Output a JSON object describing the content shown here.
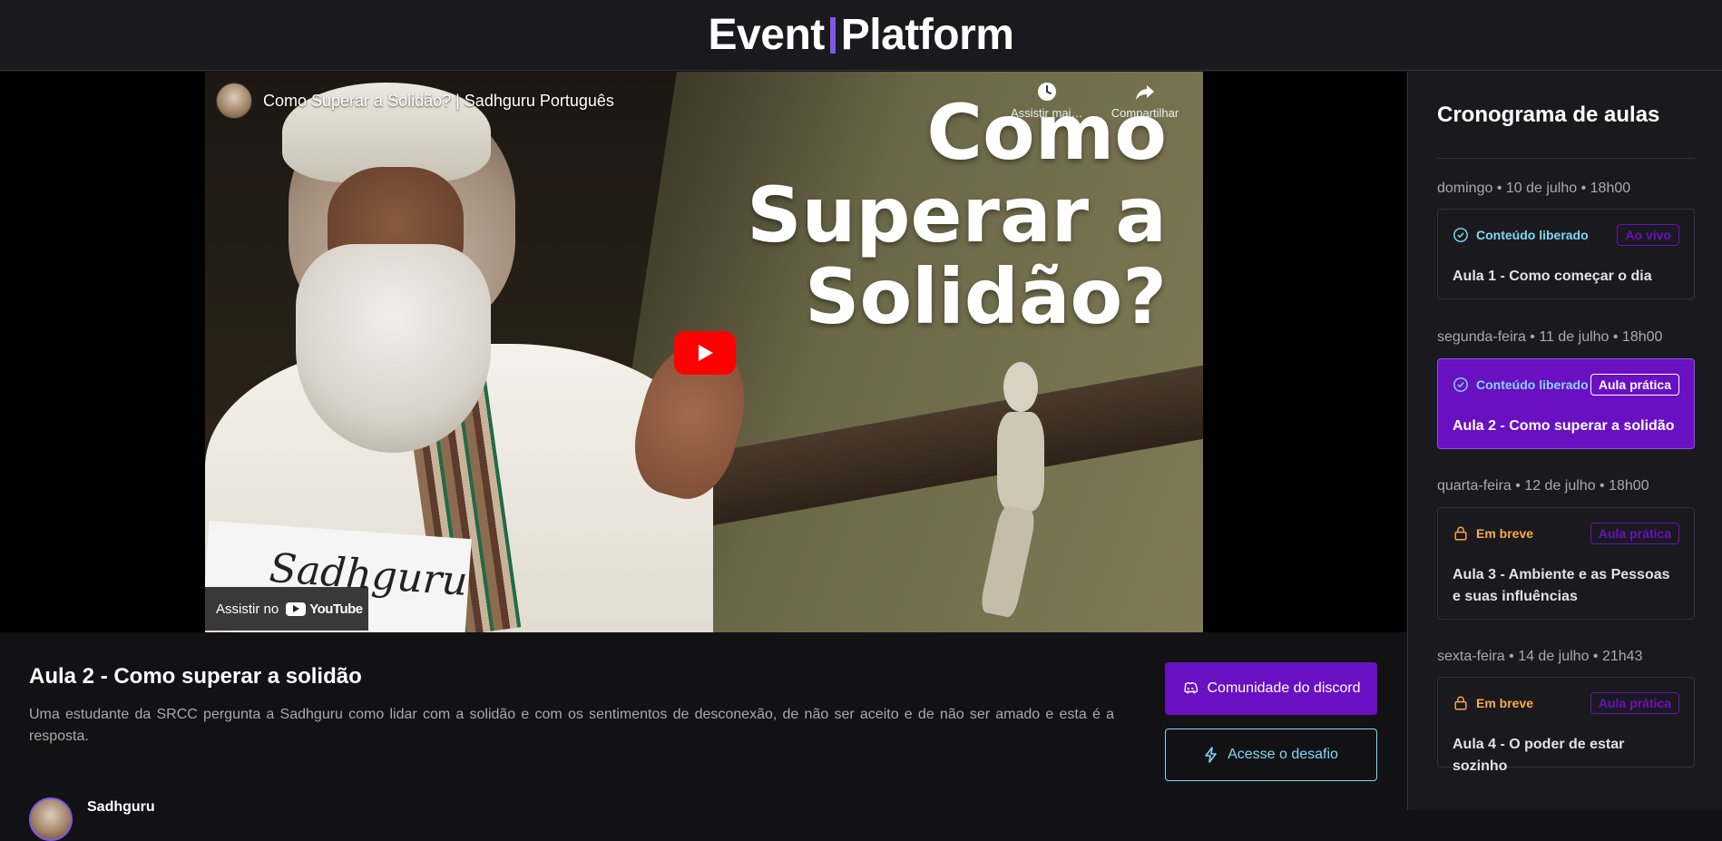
{
  "header": {
    "logo_left": "Event",
    "logo_right": "Platform"
  },
  "video": {
    "title": "Como Superar a Solidão? | Sadhguru Português",
    "overlay_text": "Como Superar a Solidão?",
    "actions": [
      {
        "icon": "clock-icon",
        "label": "Assistir mais tarde"
      },
      {
        "icon": "share-icon",
        "label": "Compartilhar"
      }
    ],
    "watch_on_label": "Assistir no",
    "youtube_label": "YouTube",
    "signature_text": "Sadhguru"
  },
  "lesson": {
    "title": "Aula 2 - Como superar a solidão",
    "description": "Uma estudante da SRCC pergunta a Sadhguru como lidar com a solidão e com os sentimentos de desconexão, de não ser aceito e de não ser amado e esta é a resposta.",
    "author_name": "Sadhguru"
  },
  "buttons": {
    "discord": "Comunidade do discord",
    "challenge": "Acesse o desafio"
  },
  "sidebar": {
    "title": "Cronograma de aulas",
    "lessons": [
      {
        "date": "domingo • 10 de julho • 18h00",
        "status": "Conteúdo liberado",
        "tag": "Ao vivo",
        "title": "Aula 1 - Como começar o dia",
        "active": false
      },
      {
        "date": "segunda-feira • 11 de julho • 18h00",
        "status": "Conteúdo liberado",
        "tag": "Aula prática",
        "title": "Aula 2 - Como superar a solidão",
        "active": true
      },
      {
        "date": "quarta-feira • 12 de julho • 18h00",
        "status": "Em breve",
        "tag": "Aula prática",
        "title": "Aula 3 - Ambiente e as Pessoas e suas influências",
        "active": false
      },
      {
        "date": "sexta-feira • 14 de julho • 21h43",
        "status": "Em breve",
        "tag": "Aula prática",
        "title": "Aula 4 - O poder de estar sozinho",
        "active": false
      }
    ]
  },
  "colors": {
    "brand_purple": "#8257e5",
    "active_purple": "#6910c2",
    "released_blue": "#81d8f7",
    "soon_orange": "#fba94c"
  }
}
